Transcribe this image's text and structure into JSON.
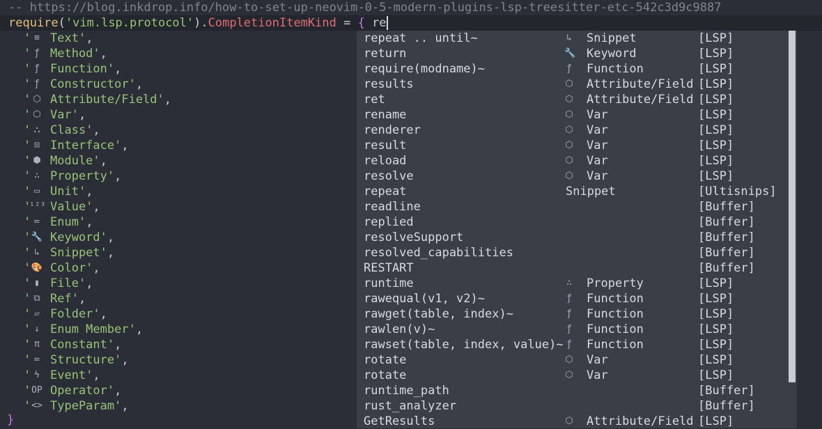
{
  "header": {
    "comment": "-- https://blog.inkdrop.info/how-to-set-up-neovim-0-5-modern-plugins-lsp-treesitter-etc-542c3d9c9887",
    "require_fn": "require",
    "open_paren": "(",
    "module_str": "'vim.lsp.protocol'",
    "close_paren": ").",
    "property": "CompletionItemKind",
    "assign": " = ",
    "brace": "{",
    "typed": " re"
  },
  "kinds": [
    {
      "icon": "≡",
      "name": "Text'",
      "tail": ","
    },
    {
      "icon": "ƒ",
      "name": "Method'",
      "tail": ","
    },
    {
      "icon": "ƒ",
      "name": "Function'",
      "tail": ","
    },
    {
      "icon": "ƒ",
      "name": "Constructor'",
      "tail": ","
    },
    {
      "icon": "⬡",
      "name": "Attribute/Field'",
      "tail": ","
    },
    {
      "icon": "⬡",
      "name": "Var'",
      "tail": ","
    },
    {
      "icon": "⛬",
      "name": "Class'",
      "tail": ","
    },
    {
      "icon": "⊡",
      "name": "Interface'",
      "tail": ","
    },
    {
      "icon": "⬢",
      "name": "Module'",
      "tail": ","
    },
    {
      "icon": "∴",
      "name": "Property'",
      "tail": ","
    },
    {
      "icon": "▭",
      "name": "Unit'",
      "tail": ","
    },
    {
      "icon": "¹²³",
      "name": "Value'",
      "tail": ","
    },
    {
      "icon": "≔",
      "name": "Enum'",
      "tail": ","
    },
    {
      "icon": "🔧",
      "name": "Keyword'",
      "tail": ","
    },
    {
      "icon": "↳",
      "name": "Snippet'",
      "tail": ","
    },
    {
      "icon": "🎨",
      "name": "Color'",
      "tail": ","
    },
    {
      "icon": "▮",
      "name": "File'",
      "tail": ","
    },
    {
      "icon": "⧉",
      "name": "Ref'",
      "tail": ","
    },
    {
      "icon": "▱",
      "name": "Folder'",
      "tail": ","
    },
    {
      "icon": "↓",
      "name": "Enum Member'",
      "tail": ","
    },
    {
      "icon": "π",
      "name": "Constant'",
      "tail": ","
    },
    {
      "icon": "≔",
      "name": "Structure'",
      "tail": ","
    },
    {
      "icon": "ϟ",
      "name": "Event'",
      "tail": ","
    },
    {
      "icon": "OP",
      "name": "Operator'",
      "tail": ","
    },
    {
      "icon": "<>",
      "name": "TypeParam'",
      "tail": ","
    }
  ],
  "closing_brace": "}",
  "completion_menu": [
    {
      "word": "repeat .. until~",
      "icon": "↳",
      "kind": "Snippet",
      "source": "[LSP]"
    },
    {
      "word": "return",
      "icon": "🔧",
      "kind": "Keyword",
      "source": "[LSP]"
    },
    {
      "word": "require(modname)~",
      "icon": "ƒ",
      "kind": "Function",
      "source": "[LSP]"
    },
    {
      "word": "results",
      "icon": "⬡",
      "kind": "Attribute/Field",
      "source": "[LSP]"
    },
    {
      "word": "ret",
      "icon": "⬡",
      "kind": "Attribute/Field",
      "source": "[LSP]"
    },
    {
      "word": "rename",
      "icon": "⬡",
      "kind": "Var",
      "source": "[LSP]"
    },
    {
      "word": "renderer",
      "icon": "⬡",
      "kind": "Var",
      "source": "[LSP]"
    },
    {
      "word": "result",
      "icon": "⬡",
      "kind": "Var",
      "source": "[LSP]"
    },
    {
      "word": "reload",
      "icon": "⬡",
      "kind": "Var",
      "source": "[LSP]"
    },
    {
      "word": "resolve",
      "icon": "⬡",
      "kind": "Var",
      "source": "[LSP]"
    },
    {
      "word": "repeat",
      "icon": "",
      "kind": "Snippet",
      "source": "[Ultisnips]",
      "kind_offset": true
    },
    {
      "word": "readline",
      "icon": "",
      "kind": "",
      "source": "[Buffer]"
    },
    {
      "word": "replied",
      "icon": "",
      "kind": "",
      "source": "[Buffer]"
    },
    {
      "word": "resolveSupport",
      "icon": "",
      "kind": "",
      "source": "[Buffer]"
    },
    {
      "word": "resolved_capabilities",
      "icon": "",
      "kind": "",
      "source": "[Buffer]"
    },
    {
      "word": "RESTART",
      "icon": "",
      "kind": "",
      "source": "[Buffer]"
    },
    {
      "word": "runtime",
      "icon": "∴",
      "kind": "Property",
      "source": "[LSP]"
    },
    {
      "word": "rawequal(v1, v2)~",
      "icon": "ƒ",
      "kind": "Function",
      "source": "[LSP]"
    },
    {
      "word": "rawget(table, index)~",
      "icon": "ƒ",
      "kind": "Function",
      "source": "[LSP]"
    },
    {
      "word": "rawlen(v)~",
      "icon": "ƒ",
      "kind": "Function",
      "source": "[LSP]"
    },
    {
      "word": "rawset(table, index, value)~",
      "icon": "ƒ",
      "kind": "Function",
      "source": "[LSP]"
    },
    {
      "word": "rotate",
      "icon": "⬡",
      "kind": "Var",
      "source": "[LSP]"
    },
    {
      "word": "rotate",
      "icon": "⬡",
      "kind": "Var",
      "source": "[LSP]"
    },
    {
      "word": "runtime_path",
      "icon": "",
      "kind": "",
      "source": "[Buffer]"
    },
    {
      "word": "rust_analyzer",
      "icon": "",
      "kind": "",
      "source": "[Buffer]"
    },
    {
      "word": "GetResults",
      "icon": "⬡",
      "kind": "Attribute/Field",
      "source": "[LSP]"
    }
  ]
}
